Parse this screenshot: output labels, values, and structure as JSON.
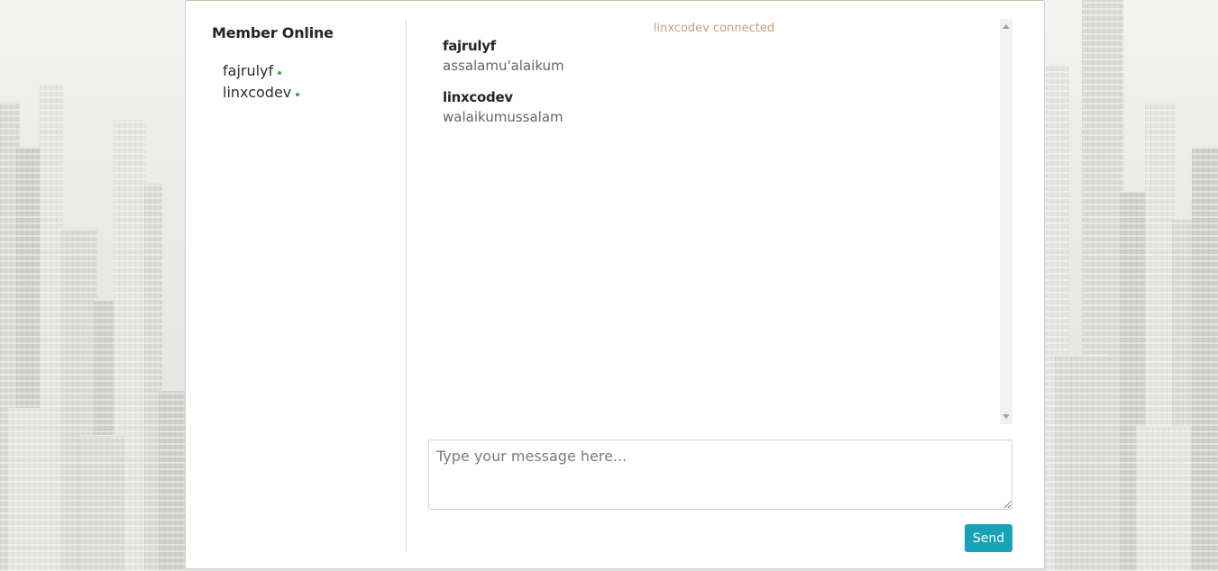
{
  "sidebar": {
    "title": "Member Online",
    "members": [
      {
        "name": "fajrulyf",
        "status": "online"
      },
      {
        "name": "linxcodev",
        "status": "online"
      }
    ]
  },
  "chat": {
    "system_message": "linxcodev connected",
    "messages": [
      {
        "user": "fajrulyf",
        "text": "assalamu'alaikum"
      },
      {
        "user": "linxcodev",
        "text": "walaikumussalam"
      }
    ]
  },
  "composer": {
    "placeholder": "Type your message here...",
    "value": "",
    "send_label": "Send"
  },
  "colors": {
    "online_dot": "#3aa735",
    "system_message": "#c2a37e",
    "send_button": "#17a2b8"
  }
}
